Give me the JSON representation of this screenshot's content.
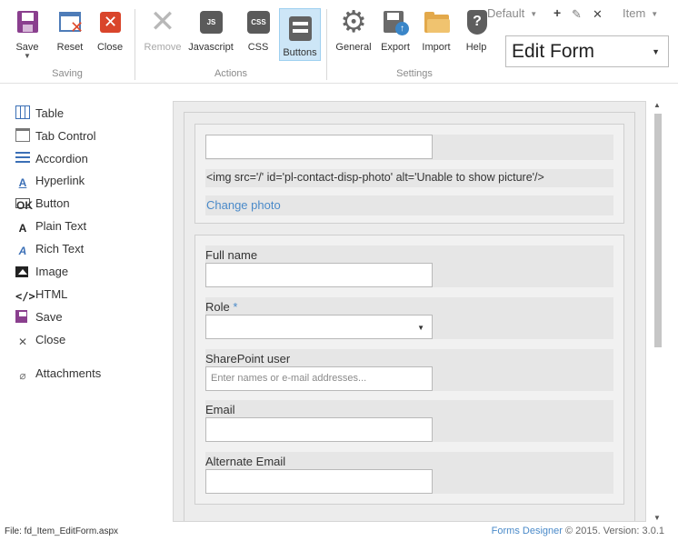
{
  "ribbon": {
    "groups": {
      "saving": "Saving",
      "actions": "Actions",
      "settings": "Settings"
    },
    "buttons": {
      "save": "Save",
      "reset": "Reset",
      "close": "Close",
      "remove": "Remove",
      "javascript": "Javascript",
      "css": "CSS",
      "buttons": "Buttons",
      "general": "General",
      "export": "Export",
      "import": "Import",
      "help": "Help"
    },
    "icon_text": {
      "javascript": "JS",
      "css": "CSS",
      "help": "?"
    },
    "top_controls": {
      "default_select": "Default",
      "item_select": "Item"
    },
    "form_select": "Edit Form"
  },
  "toolbox": {
    "items": [
      {
        "label": "Table",
        "icon": "table-icon"
      },
      {
        "label": "Tab Control",
        "icon": "tab-control-icon"
      },
      {
        "label": "Accordion",
        "icon": "accordion-icon"
      },
      {
        "label": "Hyperlink",
        "icon": "hyperlink-icon"
      },
      {
        "label": "Button",
        "icon": "button-icon"
      },
      {
        "label": "Plain Text",
        "icon": "plain-text-icon"
      },
      {
        "label": "Rich Text",
        "icon": "rich-text-icon"
      },
      {
        "label": "Image",
        "icon": "image-icon"
      },
      {
        "label": "HTML",
        "icon": "html-icon"
      },
      {
        "label": "Save",
        "icon": "save-icon"
      },
      {
        "label": "Close",
        "icon": "close-icon"
      },
      {
        "label": "Attachments",
        "icon": "paperclip-icon"
      }
    ],
    "icon_glyphs": {
      "hyperlink": "A",
      "button": "OK",
      "plain_text": "A",
      "rich_text": "A",
      "html": "</>",
      "close": "✕",
      "attachments": "⌀"
    }
  },
  "form": {
    "photo_panel": {
      "photo_input_value": "",
      "img_code": "<img src='/' id='pl-contact-disp-photo' alt='Unable to show picture'/>",
      "change_photo_link": "Change photo"
    },
    "fields": {
      "full_name": {
        "label": "Full name",
        "value": ""
      },
      "role": {
        "label": "Role",
        "required_marker": "*",
        "value": ""
      },
      "sharepoint_user": {
        "label": "SharePoint user",
        "placeholder": "Enter names or e-mail addresses..."
      },
      "email": {
        "label": "Email",
        "value": ""
      },
      "alternate_email": {
        "label": "Alternate Email",
        "value": ""
      }
    }
  },
  "footer": {
    "file_label": "File: fd_Item_EditForm.aspx",
    "brand": "Forms Designer",
    "copyright": "© 2015. Version: 3.0.1"
  },
  "colors": {
    "accent": "#4a8ac9",
    "save_purple": "#8a3f8e",
    "close_red": "#d9452b",
    "active_button_bg": "#cde6f7"
  }
}
